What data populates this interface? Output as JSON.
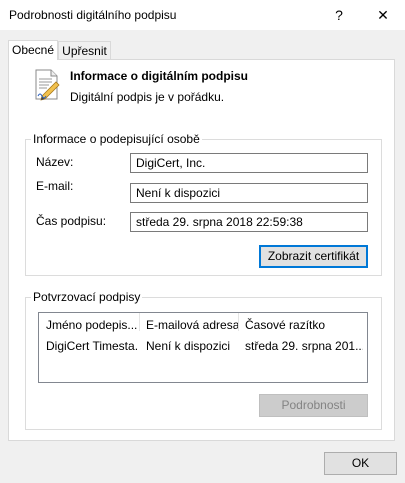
{
  "window": {
    "title": "Podrobnosti digitálního podpisu",
    "help_glyph": "?",
    "close_glyph": "✕"
  },
  "tabs": [
    {
      "label": "Obecné"
    },
    {
      "label": "Upřesnit"
    }
  ],
  "info": {
    "heading": "Informace o digitálním podpisu",
    "status": "Digitální podpis je v pořádku.",
    "icon": "signed-document-icon"
  },
  "signer": {
    "legend": "Informace o podepisující osobě",
    "name_label": "Název:",
    "name_value": "DigiCert, Inc.",
    "email_label": "E-mail:",
    "email_value": "Není k dispozici",
    "time_label": "Čas podpisu:",
    "time_value": "středa 29. srpna 2018 22:59:38",
    "view_cert_button": "Zobrazit certifikát"
  },
  "countersig": {
    "legend": "Potvrzovací podpisy",
    "columns": [
      "Jméno podepis...",
      "E-mailová adresa:",
      "Časové razítko"
    ],
    "rows": [
      [
        "DigiCert Timesta...",
        "Není k dispozici",
        "středa 29. srpna 201..."
      ]
    ],
    "details_button": "Podrobnosti"
  },
  "footer": {
    "ok_button": "OK"
  },
  "colors": {
    "accent": "#0078d7",
    "window_bg": "#f0f0f0"
  }
}
